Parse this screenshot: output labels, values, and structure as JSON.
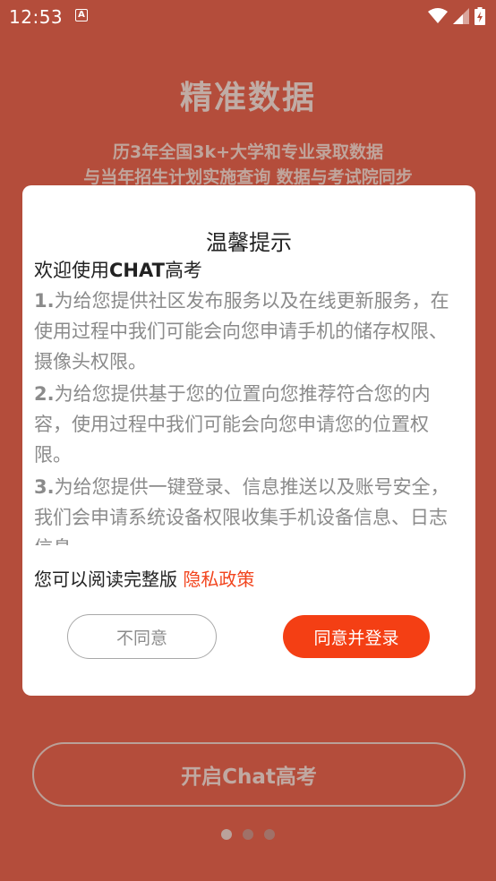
{
  "status_bar": {
    "time": "12:53",
    "notification_icon": "a-box-icon",
    "icons": [
      "wifi-icon",
      "signal-icon",
      "battery-charging-icon"
    ]
  },
  "background": {
    "title": "精准数据",
    "subtitle_line1": "历3年全国3k+大学和专业录取数据",
    "subtitle_line2": "与当年招生计划实施查询 数据与考试院同步",
    "start_button": "开启Chat高考",
    "page_dots": 3,
    "active_dot": 1
  },
  "dialog": {
    "title": "温馨提示",
    "welcome_prefix": "欢迎使用",
    "welcome_brand": "CHAT",
    "welcome_suffix": "高考",
    "items": [
      {
        "num": "1.",
        "text": "为给您提供社区发布服务以及在线更新服务，在使用过程中我们可能会向您申请手机的储存权限、摄像头权限。"
      },
      {
        "num": "2.",
        "text": "为给您提供基于您的位置向您推荐符合您的内容，使用过程中我们可能会向您申请您的位置权限。"
      },
      {
        "num": "3.",
        "text": "为给您提供一键登录、信息推送以及账号安全，我们会申请系统设备权限收集手机设备信息、日志信息。"
      }
    ],
    "policy_prefix": "您可以阅读完整版 ",
    "policy_link": "隐私政策",
    "disagree_label": "不同意",
    "agree_label": "同意并登录"
  },
  "colors": {
    "accent": "#f43f14",
    "link": "#f2451e",
    "background": "#e2614a"
  }
}
